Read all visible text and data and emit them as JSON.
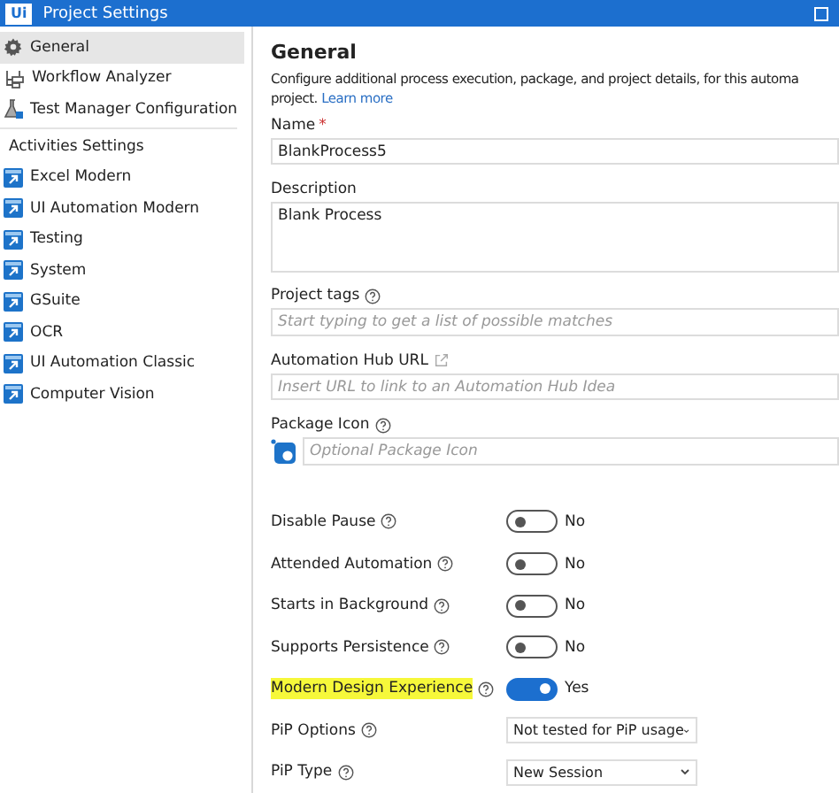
{
  "window": {
    "logo": "Ui",
    "title": "Project Settings"
  },
  "sidebar": {
    "items": [
      {
        "label": "General",
        "selected": true
      },
      {
        "label": "Workflow Analyzer",
        "selected": false
      },
      {
        "label": "Test Manager Configuration",
        "selected": false
      }
    ],
    "section_title": "Activities Settings",
    "activities": [
      {
        "label": "Excel Modern",
        "selected": false
      },
      {
        "label": "UI Automation Modern",
        "selected": false
      },
      {
        "label": "Testing",
        "selected": false
      },
      {
        "label": "System",
        "selected": false
      },
      {
        "label": "GSuite",
        "selected": false
      },
      {
        "label": "OCR",
        "selected": false
      },
      {
        "label": "UI Automation Classic",
        "selected": false
      },
      {
        "label": "Computer Vision",
        "selected": false
      }
    ]
  },
  "main": {
    "title": "General",
    "intro": "Configure additional process execution, package, and project details, for this automa",
    "intro_end": "project.",
    "intro_link": "Learn more",
    "fields": [
      {
        "kind": "input",
        "label": "Name",
        "required_mark": "*",
        "value": "BlankProcess5"
      },
      {
        "kind": "textarea",
        "label": "Description",
        "value": "Blank Process"
      },
      {
        "kind": "input",
        "label": "Project tags",
        "help": true,
        "placeholder": "Start typing to get a list of possible matches"
      },
      {
        "kind": "input",
        "label": "Automation Hub URL",
        "external": true,
        "placeholder": "Insert URL to link to an Automation Hub Idea"
      },
      {
        "kind": "icon",
        "label": "Package Icon",
        "help": true,
        "placeholder": "Optional Package Icon"
      }
    ],
    "options": [
      {
        "kind": "toggle",
        "label": "Disable Pause",
        "on": false,
        "value": "No",
        "highlighted": false
      },
      {
        "kind": "toggle",
        "label": "Attended Automation",
        "on": false,
        "value": "No",
        "highlighted": false
      },
      {
        "kind": "toggle",
        "label": "Starts in Background",
        "on": false,
        "value": "No",
        "highlighted": false
      },
      {
        "kind": "toggle",
        "label": "Supports Persistence",
        "on": false,
        "value": "No",
        "highlighted": false
      },
      {
        "kind": "toggle",
        "label": "Modern Design Experience",
        "on": true,
        "value": "Yes",
        "highlighted": true
      },
      {
        "kind": "select",
        "label": "PiP Options",
        "value": "Not tested for PiP usage",
        "highlighted": false
      },
      {
        "kind": "select",
        "label": "PiP Type",
        "value": "New Session",
        "highlighted": false
      }
    ]
  }
}
